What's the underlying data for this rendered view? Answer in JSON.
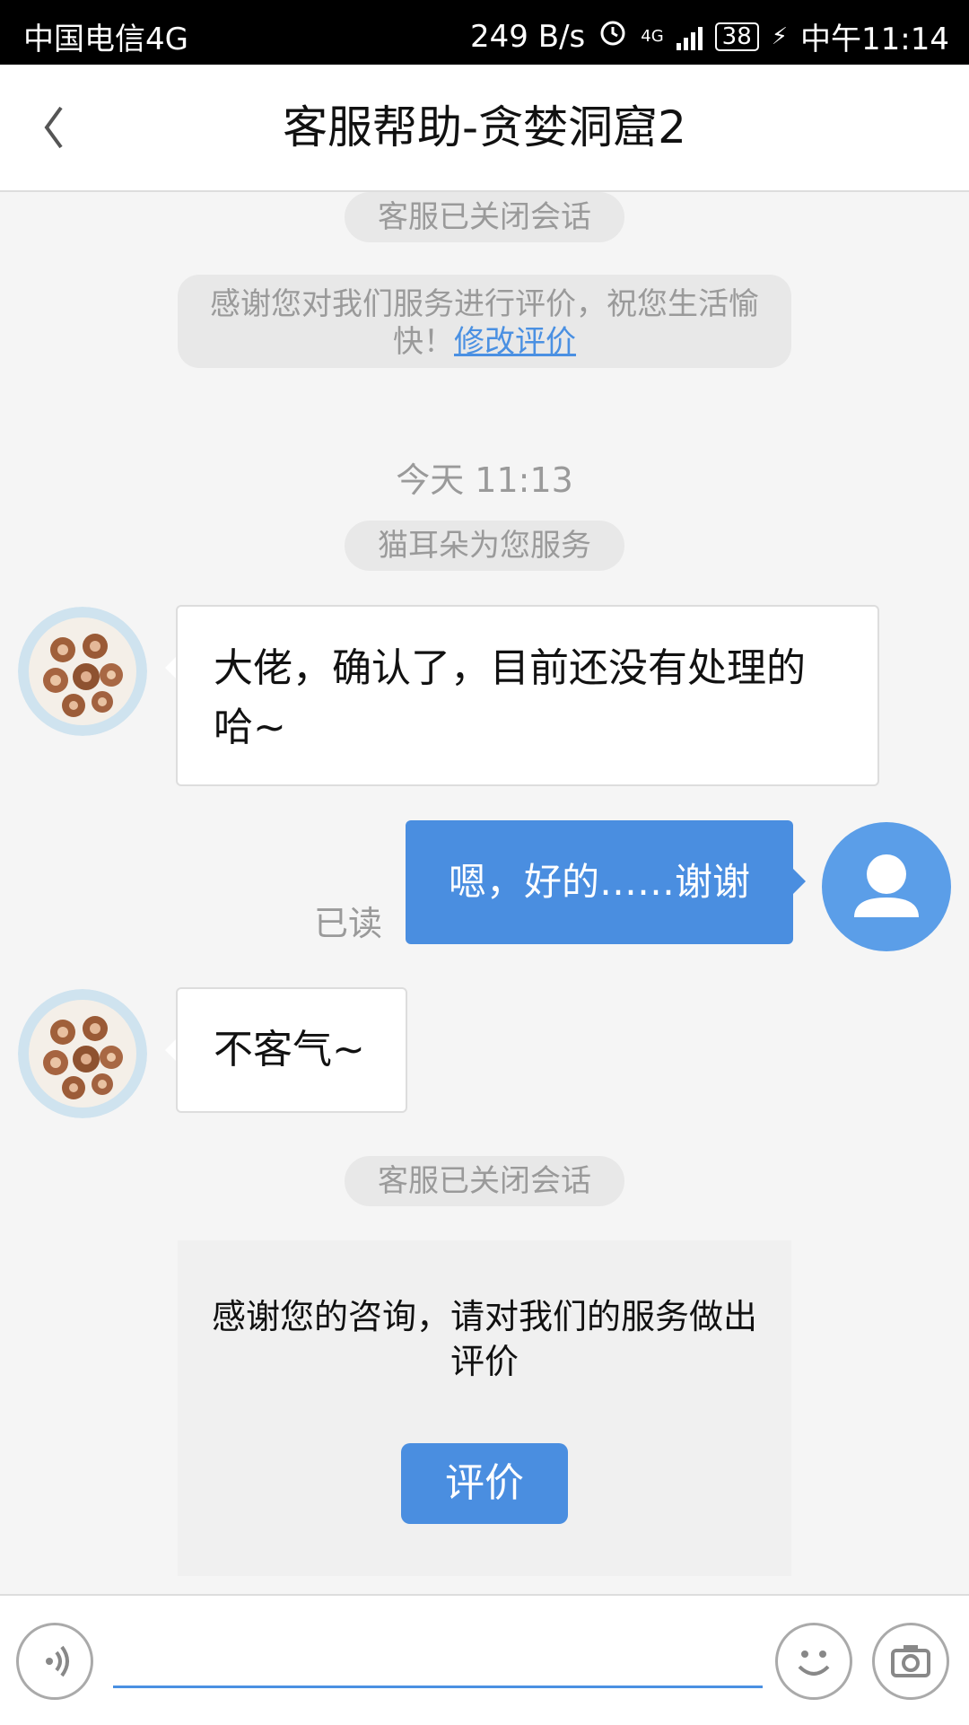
{
  "status_bar": {
    "carrier": "中国电信4G",
    "speed": "249 B/s",
    "network": "4G",
    "battery": "38",
    "time": "中午11:14"
  },
  "header": {
    "title": "客服帮助-贪婪洞窟2"
  },
  "messages": {
    "closed_top": "客服已关闭会话",
    "thanks_rating_text": "感谢您对我们服务进行评价，祝您生活愉快！",
    "modify_rating_link": "修改评价",
    "timestamp": "今天 11:13",
    "agent_service": "猫耳朵为您服务",
    "agent_msg_1": "大佬，确认了，目前还没有处理的哈~",
    "user_msg_1": "嗯，好的……谢谢",
    "read_status": "已读",
    "agent_msg_2": "不客气~",
    "closed_bottom": "客服已关闭会话",
    "rate_prompt": "感谢您的咨询，请对我们的服务做出评价",
    "rate_button": "评价"
  },
  "input_bar": {
    "placeholder": ""
  },
  "colors": {
    "accent": "#4a8ee0",
    "link": "#4a90e2",
    "system_text": "#9a9a9a"
  }
}
